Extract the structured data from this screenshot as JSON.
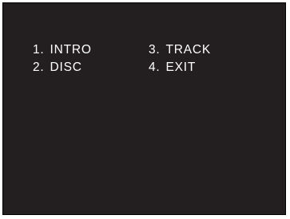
{
  "menu": {
    "items": [
      {
        "number": "1.",
        "label": "INTRO"
      },
      {
        "number": "2.",
        "label": "DISC"
      },
      {
        "number": "3.",
        "label": "TRACK"
      },
      {
        "number": "4.",
        "label": "EXIT"
      }
    ]
  },
  "colors": {
    "background": "#231f20",
    "text": "#ffffff"
  }
}
